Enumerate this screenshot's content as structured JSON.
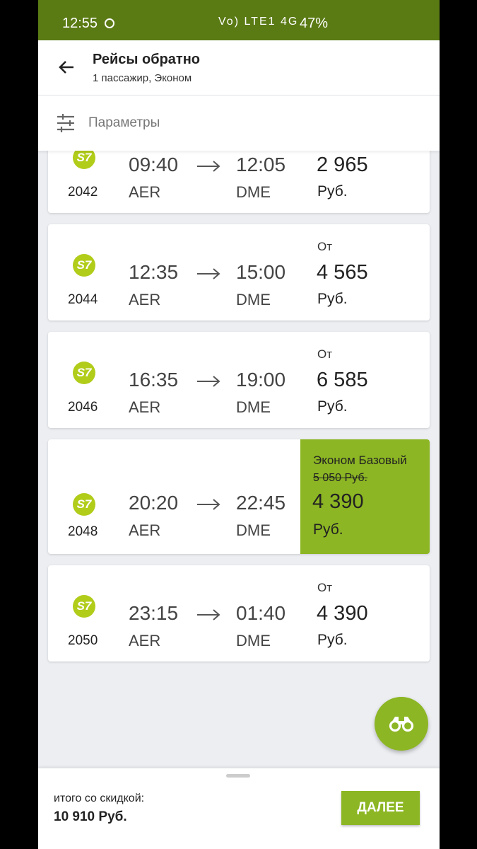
{
  "status_bar": {
    "time": "12:55",
    "indicators": "Vo) LTE1 4G",
    "battery": "47%"
  },
  "header": {
    "title": "Рейсы обратно",
    "subtitle": "1 пассажир, Эконом"
  },
  "filter": {
    "label": "Параметры"
  },
  "flights": [
    {
      "airline_logo": "S7",
      "flight_number": "2042",
      "dep_time": "09:40",
      "arr_time": "12:05",
      "dep_code": "AER",
      "arr_code": "DME",
      "from_label": "",
      "price": "2 965",
      "currency": "Руб."
    },
    {
      "airline_logo": "S7",
      "flight_number": "2044",
      "dep_time": "12:35",
      "arr_time": "15:00",
      "dep_code": "AER",
      "arr_code": "DME",
      "from_label": "От",
      "price": "4 565",
      "currency": "Руб."
    },
    {
      "airline_logo": "S7",
      "flight_number": "2046",
      "dep_time": "16:35",
      "arr_time": "19:00",
      "dep_code": "AER",
      "arr_code": "DME",
      "from_label": "От",
      "price": "6 585",
      "currency": "Руб."
    },
    {
      "airline_logo": "S7",
      "flight_number": "2048",
      "dep_time": "20:20",
      "arr_time": "22:45",
      "dep_code": "AER",
      "arr_code": "DME",
      "fare_name": "Эконом Базовый",
      "old_price": "5 050 Руб.",
      "price": "4 390",
      "currency": "Руб.",
      "selected": true
    },
    {
      "airline_logo": "S7",
      "flight_number": "2050",
      "dep_time": "23:15",
      "arr_time": "01:40",
      "dep_code": "AER",
      "arr_code": "DME",
      "from_label": "От",
      "price": "4 390",
      "currency": "Руб."
    }
  ],
  "footer": {
    "total_label": "итого со скидкой:",
    "total_value": "10 910 Руб.",
    "next_button": "ДАЛЕЕ"
  },
  "colors": {
    "accent": "#8cb623",
    "status_bar": "#5a7a14",
    "logo": "#b2cc1a"
  },
  "icons": {
    "back": "arrow-left-icon",
    "filter": "sliders-icon",
    "fab": "binoculars-icon"
  }
}
